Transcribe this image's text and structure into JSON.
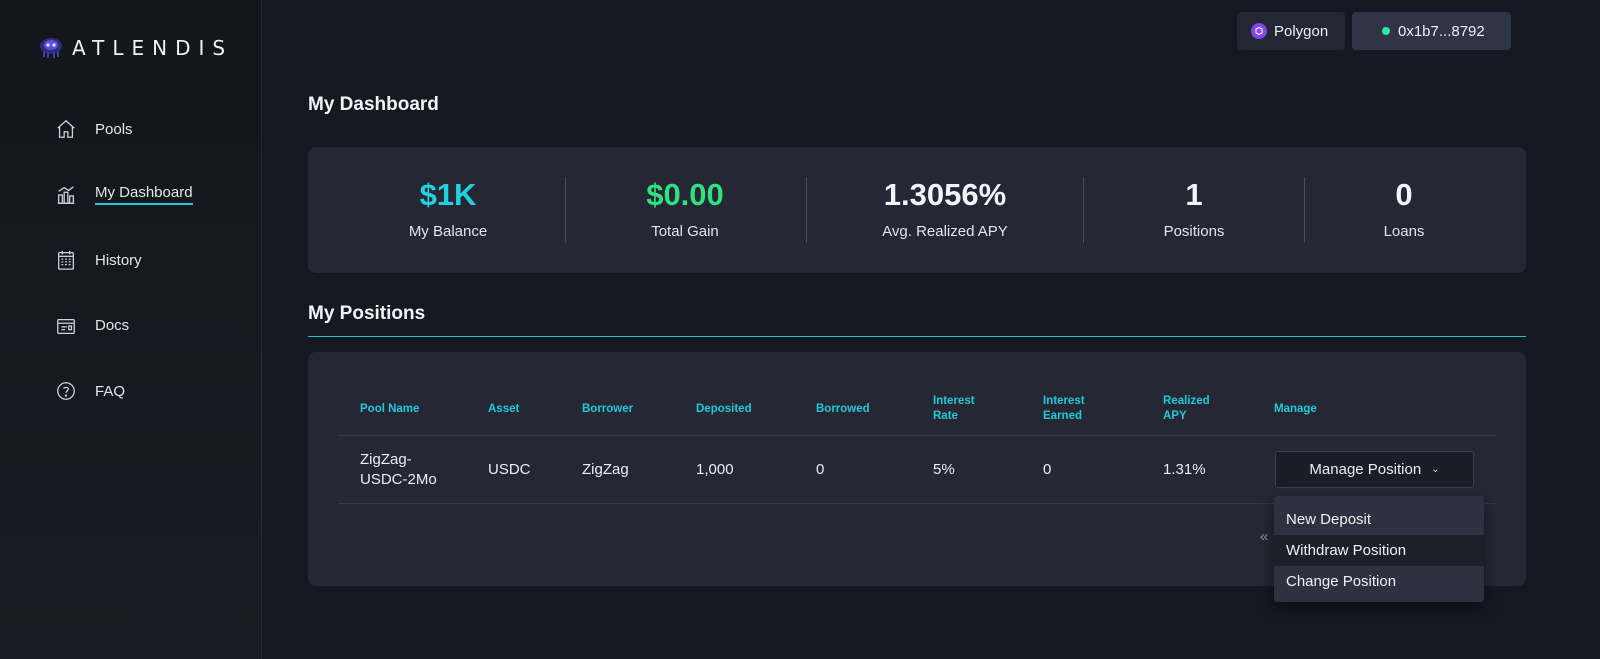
{
  "brand": {
    "name": "ATLENDIS",
    "logo_icon": "atlendis-logo-icon"
  },
  "sidebar": {
    "items": [
      {
        "label": "Pools",
        "icon": "house-icon"
      },
      {
        "label": "My Dashboard",
        "icon": "chart-house-icon",
        "active": true
      },
      {
        "label": "History",
        "icon": "calendar-icon"
      },
      {
        "label": "Docs",
        "icon": "document-box-icon"
      },
      {
        "label": "FAQ",
        "icon": "help-circle-icon"
      }
    ]
  },
  "header": {
    "network_label": "Polygon",
    "wallet_address": "0x1b7...8792",
    "wallet_status_color": "#2fe3a0"
  },
  "dashboard": {
    "title": "My Dashboard",
    "stats": [
      {
        "value": "$1K",
        "label": "My Balance",
        "color": "#1fd2de"
      },
      {
        "value": "$0.00",
        "label": "Total Gain",
        "color": "#2ee27e"
      },
      {
        "value": "1.3056%",
        "label": "Avg. Realized APY",
        "color": "#f4f5f8"
      },
      {
        "value": "1",
        "label": "Positions",
        "color": "#f4f5f8"
      },
      {
        "value": "0",
        "label": "Loans",
        "color": "#f4f5f8"
      }
    ]
  },
  "positions": {
    "title": "My Positions",
    "columns": [
      {
        "line1": "Pool Name",
        "line2": ""
      },
      {
        "line1": "Asset",
        "line2": ""
      },
      {
        "line1": "Borrower",
        "line2": ""
      },
      {
        "line1": "Deposited",
        "line2": ""
      },
      {
        "line1": "Borrowed",
        "line2": ""
      },
      {
        "line1": "Interest",
        "line2": "Rate"
      },
      {
        "line1": "Interest",
        "line2": "Earned"
      },
      {
        "line1": "Realized",
        "line2": "APY"
      },
      {
        "line1": "Manage",
        "line2": ""
      }
    ],
    "rows": [
      {
        "pool_name_line1": "ZigZag-",
        "pool_name_line2": "USDC-2Mo",
        "asset": "USDC",
        "borrower": "ZigZag",
        "deposited": "1,000",
        "borrowed": "0",
        "interest_rate": "5%",
        "interest_earned": "0",
        "realized_apy": "1.31%",
        "manage_label": "Manage Position"
      }
    ],
    "pager_prev": "«"
  },
  "manage_menu": {
    "items": [
      "New Deposit",
      "Withdraw Position",
      "Change Position"
    ],
    "hovered_index": 1
  },
  "colors": {
    "accent": "#1fc6d2",
    "background": "#161821",
    "card": "#252834"
  }
}
